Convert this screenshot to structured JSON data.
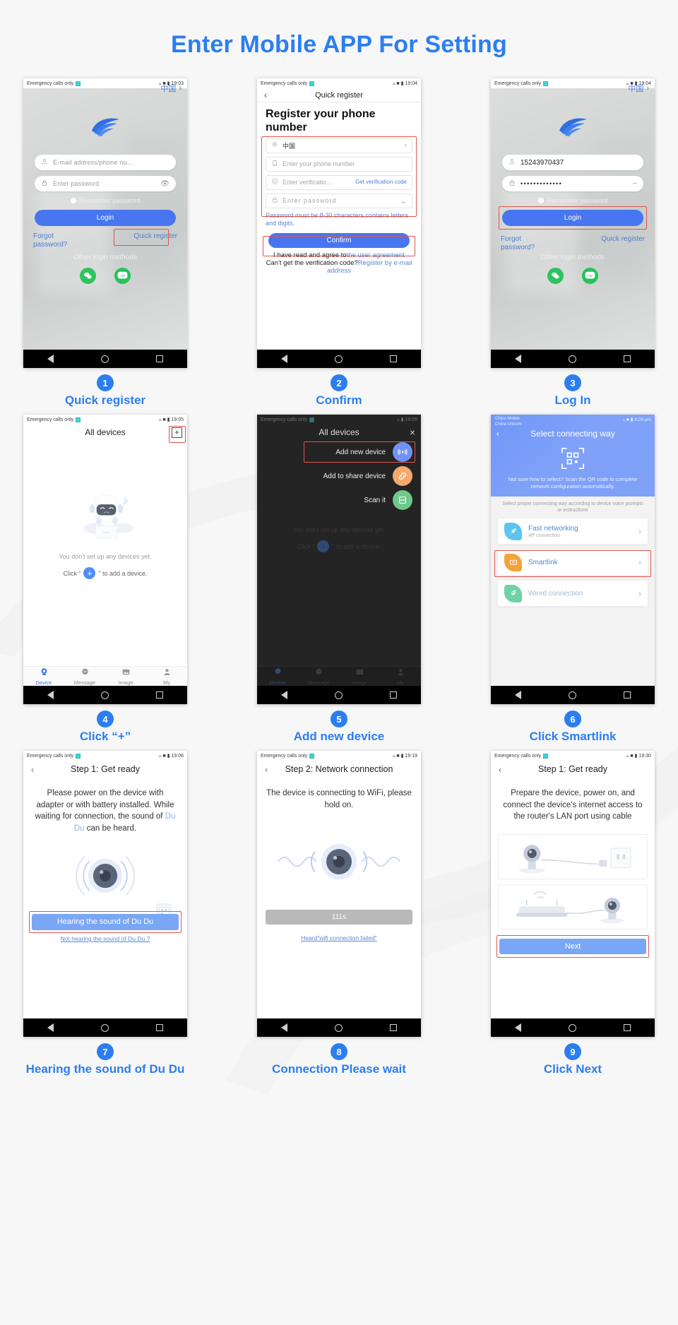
{
  "title": "Enter Mobile APP For Setting",
  "accent": "#2b7ef0",
  "highlight": "#e0544b",
  "common": {
    "carrier": "Emergency calls only",
    "sim_icon": "sim-icon",
    "wifi_icon": "wifi-icon",
    "signal_icon": "signal-icon",
    "battery_icon": "battery-icon",
    "nav_back": "back-triangle-icon",
    "nav_home": "home-circle-icon",
    "nav_recents": "recents-square-icon"
  },
  "steps": [
    {
      "num": "1",
      "caption": "Quick register",
      "time": "19:03",
      "screen": {
        "country": "中国",
        "email_placeholder": "E-mail address/phone nu...",
        "password_placeholder": "Enter password",
        "remember": "Remember password",
        "login": "Login",
        "forgot": "Forgot password?",
        "quick_register": "Quick register",
        "other_methods": "Other login methods",
        "social": [
          "wechat-icon",
          "line-icon"
        ]
      }
    },
    {
      "num": "2",
      "caption": "Confirm",
      "time": "19:04",
      "screen": {
        "topbar_title": "Quick register",
        "heading": "Register your phone number",
        "country": "中国",
        "phone_placeholder": "Enter your phone number",
        "code_placeholder": "Enter verificatio...",
        "get_code": "Get verification code",
        "password_placeholder": "Enter password",
        "note": "Password must be 8-30 characters,contains letters and digits.",
        "confirm": "Confirm",
        "agree_prefix": "I have read and agree to",
        "agree_link": "the user agreement",
        "cant_get": "Can't get the verification code?",
        "register_email_link": "Register by e-mail address"
      }
    },
    {
      "num": "3",
      "caption": "Log In",
      "time": "19:04",
      "screen": {
        "country": "中国",
        "phone_value": "15243970437",
        "password_value": "•••••••••••••",
        "remember": "Remember password",
        "login": "Login",
        "forgot": "Forgot password?",
        "quick_register": "Quick register",
        "other_methods": "Other login methods",
        "social": [
          "wechat-icon",
          "line-icon"
        ]
      }
    },
    {
      "num": "4",
      "caption": "Click “+”",
      "time": "19:05",
      "screen": {
        "title": "All devices",
        "add_button": "+",
        "empty_text": "You don't set up any devices yet.",
        "click_prefix": "Click “",
        "click_suffix": "” to add a device.",
        "tabs": [
          {
            "label": "Device",
            "icon": "camera-icon",
            "active": true
          },
          {
            "label": "Message",
            "icon": "message-icon",
            "active": false
          },
          {
            "label": "Image",
            "icon": "image-icon",
            "active": false
          },
          {
            "label": "My",
            "icon": "person-icon",
            "active": false
          }
        ]
      }
    },
    {
      "num": "5",
      "caption": "Add new device",
      "time": "19:05",
      "screen": {
        "title": "All devices",
        "close": "×",
        "items": [
          {
            "label": "Add new device",
            "icon": "wifi-radiate-icon",
            "color": "#6e92f5"
          },
          {
            "label": "Add to share device",
            "icon": "link-icon",
            "color": "#f5a96e"
          },
          {
            "label": "Scan it",
            "icon": "scan-icon",
            "color": "#6ec98a"
          }
        ],
        "ghost_empty": "You don't set up any devices yet.",
        "ghost_click_prefix": "Click “",
        "ghost_click_suffix": "” to add a device.",
        "tabs": [
          {
            "label": "Device",
            "icon": "camera-icon"
          },
          {
            "label": "Message",
            "icon": "message-icon"
          },
          {
            "label": "Image",
            "icon": "image-icon"
          },
          {
            "label": "My",
            "icon": "person-icon"
          }
        ]
      }
    },
    {
      "num": "6",
      "caption": "Click Smartlink",
      "time": "6:26 pm",
      "screen": {
        "carrier_line1": "China Mobile",
        "carrier_line2": "China Unicom",
        "title": "Select connecting way",
        "qr_icon": "qr-code-icon",
        "hero_note": "Not sure how to select? Scan the QR code to complete network configuration automatically.",
        "sub_note": "Select proper connecting way according to device voice prompts or instructions",
        "options": [
          {
            "label": "Fast networking",
            "sub": "AP connection",
            "icon": "rocket-icon",
            "color": "#5ec3ef"
          },
          {
            "label": "Smartlink",
            "sub": "",
            "icon": "wifi-box-icon",
            "color": "#f5a33c"
          },
          {
            "label": "Wired connection",
            "sub": "",
            "icon": "leaf-icon",
            "color": "#6fd3a4"
          }
        ]
      }
    },
    {
      "num": "7",
      "caption": "Hearing the sound of Du Du",
      "time": "19:06",
      "screen": {
        "title": "Step 1: Get ready",
        "body_1": "Please power on the device with adapter or with battery installed. While waiting for connection, the sound of ",
        "body_du": "Du Du",
        "body_2": " can be heard.",
        "button": "Hearing the sound of Du Du",
        "link": "Not hearing the sound of Du Du ?",
        "illustration": "speaker-waves-icon"
      }
    },
    {
      "num": "8",
      "caption": "Connection Please wait",
      "time": "19:19",
      "screen": {
        "title": "Step 2: Network connection",
        "body": "The device is connecting to WiFi, please hold on.",
        "timer": "111s",
        "link": "Heard\"wifi connection failed\"",
        "illustration": "speaker-waves-icon"
      }
    },
    {
      "num": "9",
      "caption": "Click Next",
      "time": "19:30",
      "screen": {
        "title": "Step 1: Get ready",
        "body": "Prepare the device, power on, and connect the device's internet access to the router's LAN port using cable",
        "illustration_1": "camera-to-outlet-icon",
        "illustration_2": "router-to-camera-icon",
        "button": "Next"
      }
    }
  ]
}
